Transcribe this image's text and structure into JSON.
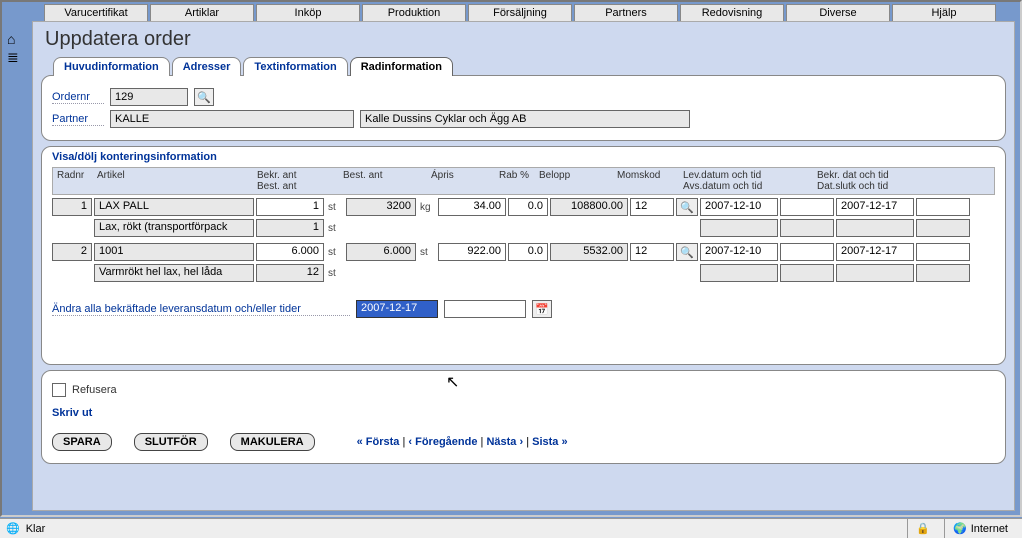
{
  "topnav": [
    "Varucertifikat",
    "Artiklar",
    "Inköp",
    "Produktion",
    "Försäljning",
    "Partners",
    "Redovisning",
    "Diverse",
    "Hjälp"
  ],
  "page_title": "Uppdatera order",
  "subtabs": {
    "items": [
      "Huvudinformation",
      "Adresser",
      "Textinformation",
      "Radinformation"
    ],
    "active_index": 3
  },
  "order_panel": {
    "ordernr_label": "Ordernr",
    "ordernr_value": "129",
    "partner_label": "Partner",
    "partner_code": "KALLE",
    "partner_name": "Kalle Dussins Cyklar och Ägg AB"
  },
  "lines_panel": {
    "toggle_label": "Visa/dölj konteringsinformation",
    "headers": {
      "radnr": "Radnr",
      "artikel": "Artikel",
      "bekr_ant": "Bekr. ant\nBest. ant",
      "best_ant": "Best. ant",
      "apris": "Ápris",
      "rab": "Rab %",
      "belopp": "Belopp",
      "momskod": "Momskod",
      "lev": "Lev.datum och tid\nAvs.datum och tid",
      "bekr": "Bekr. dat och tid\nDat.slutk och tid"
    },
    "rows": [
      {
        "radnr": "1",
        "artikel": "LAX PALL",
        "bekr_ant": "1",
        "bekr_unit": "st",
        "best_ant": "3200",
        "best_unit": "kg",
        "apris": "34.00",
        "rab": "0.0",
        "belopp": "108800.00",
        "momskod": "12",
        "lev_date": "2007-12-10",
        "lev_time": "",
        "bekr_date": "2007-12-17",
        "bekr_time": "",
        "sub_artikel": "Lax, rökt (transportförpack",
        "sub_bekr": "1",
        "sub_unit": "st"
      },
      {
        "radnr": "2",
        "artikel": "1001",
        "bekr_ant": "6.000",
        "bekr_unit": "st",
        "best_ant": "6.000",
        "best_unit": "st",
        "apris": "922.00",
        "rab": "0.0",
        "belopp": "5532.00",
        "momskod": "12",
        "lev_date": "2007-12-10",
        "lev_time": "",
        "bekr_date": "2007-12-17",
        "bekr_time": "",
        "sub_artikel": "Varmrökt hel lax, hel låda",
        "sub_bekr": "12",
        "sub_unit": "st"
      }
    ],
    "bulk_label": "Ändra alla bekräftade leveransdatum och/eller tider",
    "bulk_date": "2007-12-17",
    "bulk_time": ""
  },
  "bottom_panel": {
    "refusera_label": "Refusera",
    "skriv_ut": "Skriv ut",
    "buttons": {
      "spara": "SPARA",
      "slutfor": "SLUTFÖR",
      "makulera": "MAKULERA"
    },
    "pager": {
      "first": "« Första",
      "prev": "‹ Föregående",
      "next": "Nästa ›",
      "last": "Sista »"
    }
  },
  "statusbar": {
    "status": "Klar",
    "zone": "Internet"
  },
  "icons": {
    "home": "⌂",
    "menu": "≣",
    "search": "🔍",
    "calendar": "📅",
    "ie": "🌐",
    "lock": "🔒",
    "globe": "🌍"
  }
}
